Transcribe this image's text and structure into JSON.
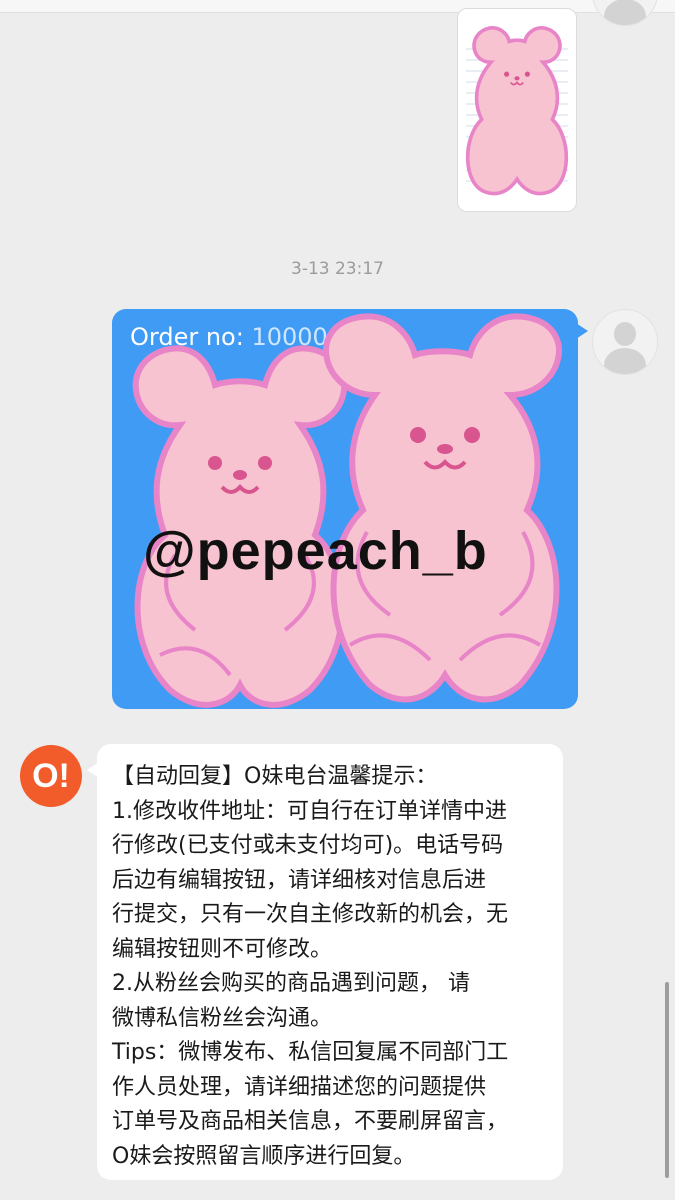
{
  "chat": {
    "timestamp": "3-13 23:17",
    "order_message": {
      "label": "Order no: ",
      "number": "10000"
    },
    "watermark": "@pepeach_b",
    "auto_reply": {
      "sender_initial": "O!",
      "lines": [
        "【自动回复】O妹电台温馨提示：",
        "1.修改收件地址：可自行在订单详情中进",
        "行修改(已支付或未支付均可)。电话号码",
        "后边有编辑按钮，请详细核对信息后进",
        "行提交，只有一次自主修改新的机会，无",
        "编辑按钮则不可修改。",
        "2.从粉丝会购买的商品遇到问题， 请",
        "微博私信粉丝会沟通。",
        "Tips：微博发布、私信回复属不同部门工",
        "作人员处理，请详细描述您的问题提供",
        "订单号及商品相关信息，不要刷屏留言，",
        "O妹会按照留言顺序进行回复。"
      ]
    }
  },
  "colors": {
    "background": "#ededed",
    "bubble_blue": "#3f9bf4",
    "bubble_white": "#ffffff",
    "brand_orange": "#f25c2a",
    "bear_pink": "#f8c3d0",
    "bear_outline": "#e884c8"
  },
  "icons": [
    "user-avatar-icon",
    "brand-logo-icon",
    "bear-sticker"
  ]
}
